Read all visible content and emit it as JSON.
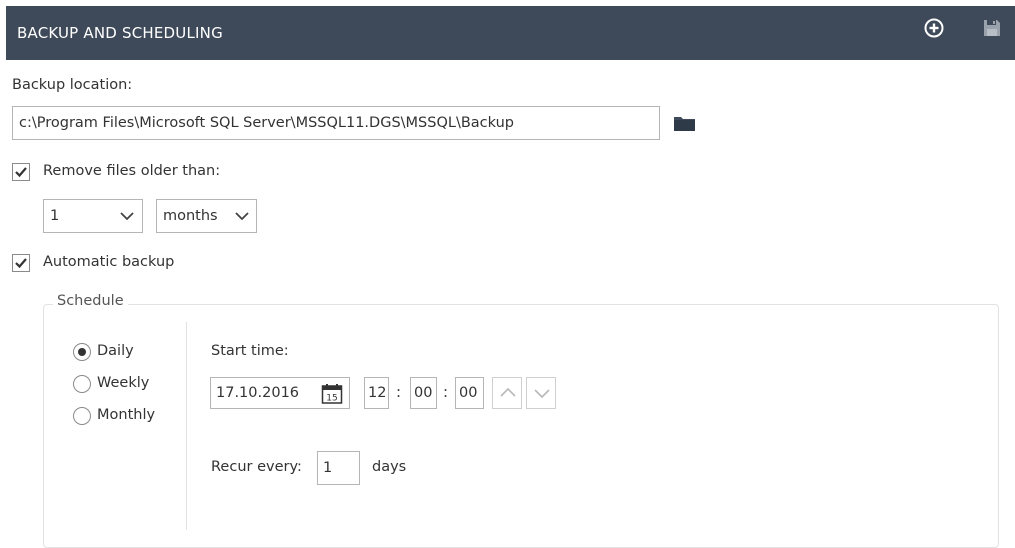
{
  "header": {
    "title": "BACKUP AND SCHEDULING",
    "icons": [
      "add-circle-icon",
      "save-icon"
    ],
    "background": "#3e4a5a"
  },
  "backup": {
    "location_label": "Backup location:",
    "location_value": "c:\\Program Files\\Microsoft SQL Server\\MSSQL11.DGS\\MSSQL\\Backup",
    "folder_icon": "folder-icon"
  },
  "retention": {
    "checkbox_label": "Remove files older than:",
    "checked": true,
    "amount": "1",
    "unit": "months"
  },
  "automatic": {
    "checkbox_label": "Automatic backup",
    "checked": true
  },
  "schedule": {
    "legend": "Schedule",
    "frequency_options": [
      {
        "label": "Daily",
        "selected": true
      },
      {
        "label": "Weekly",
        "selected": false
      },
      {
        "label": "Monthly",
        "selected": false
      }
    ],
    "start_time_label": "Start time:",
    "start_date": "17.10.2016",
    "calendar_day": "15",
    "hour": "12",
    "minute": "00",
    "second": "00",
    "time_separator": ":",
    "recur_label": "Recur every:",
    "recur_value": "1",
    "recur_unit": "days"
  }
}
